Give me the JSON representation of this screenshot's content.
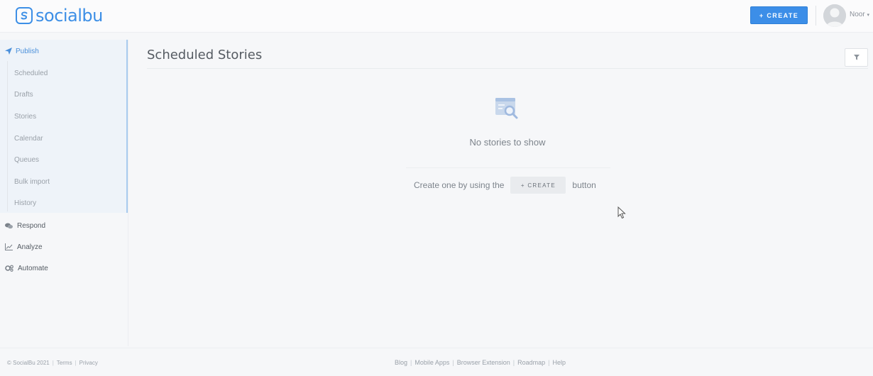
{
  "header": {
    "brand": "socialbu",
    "create_button": "+ CREATE",
    "user_name": "Noor"
  },
  "sidebar": {
    "publish": {
      "label": "Publish",
      "items": [
        "Scheduled",
        "Drafts",
        "Stories",
        "Calendar",
        "Queues",
        "Bulk import",
        "History"
      ]
    },
    "items": [
      {
        "label": "Respond",
        "icon": "comments-icon"
      },
      {
        "label": "Analyze",
        "icon": "chart-line-icon"
      },
      {
        "label": "Automate",
        "icon": "cogs-icon"
      }
    ]
  },
  "main": {
    "title": "Scheduled Stories",
    "empty_message": "No stories to show",
    "create_prefix": "Create one by using the",
    "create_button": "+ CREATE",
    "create_suffix": "button"
  },
  "footer": {
    "copyright": "© SocialBu 2021",
    "left_links": [
      "Terms",
      "Privacy"
    ],
    "links": [
      "Blog",
      "Mobile Apps",
      "Browser Extension",
      "Roadmap",
      "Help"
    ]
  },
  "colors": {
    "accent": "#3c8ee8",
    "active_bg": "#eef3f9",
    "active_border": "#a9cbee"
  }
}
